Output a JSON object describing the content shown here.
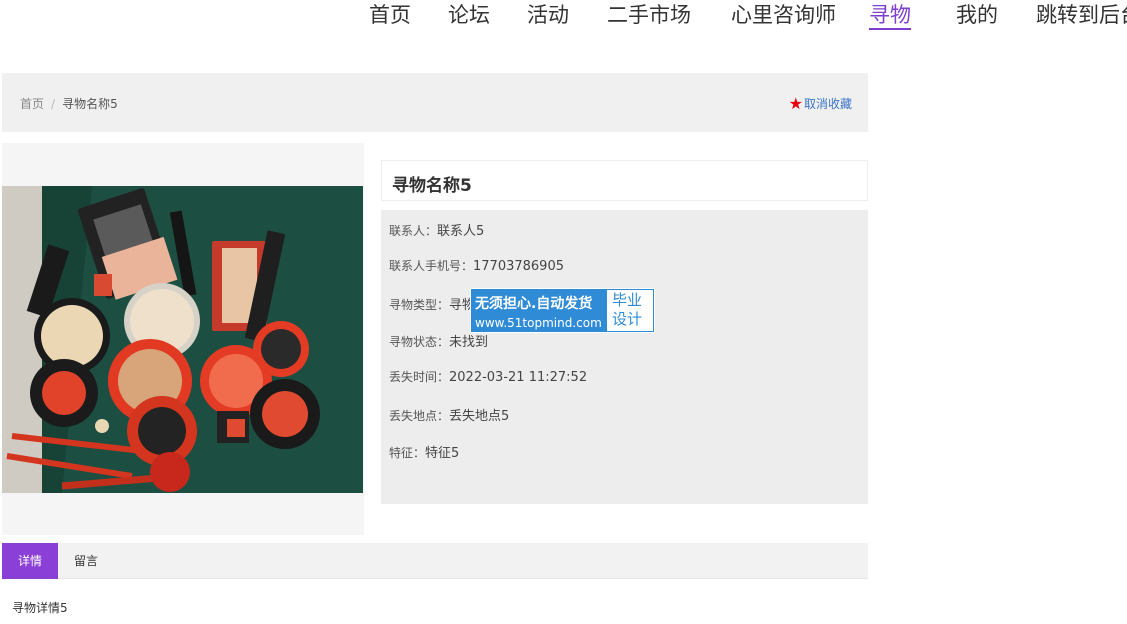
{
  "nav": {
    "items": [
      "首页",
      "论坛",
      "活动",
      "二手市场",
      "心里咨询师",
      "寻物",
      "我的",
      "跳转到后台"
    ],
    "active_index": 5
  },
  "breadcrumb": {
    "home": "首页",
    "separator": "/",
    "current": "寻物名称5"
  },
  "favorite": {
    "label": "取消收藏"
  },
  "item": {
    "title": "寻物名称5",
    "fields": [
      {
        "label": "联系人：",
        "value": "联系人5"
      },
      {
        "label": "联系人手机号：",
        "value": "17703786905"
      },
      {
        "label": "寻物类型：",
        "value": "寻物类型5"
      },
      {
        "label": "寻物状态：",
        "value": "未找到"
      },
      {
        "label": "丢失时间：",
        "value": "2022-03-21 11:27:52"
      },
      {
        "label": "丢失地点：",
        "value": "丢失地点5"
      },
      {
        "label": "特征：",
        "value": "特征5"
      }
    ]
  },
  "watermark": {
    "line1": "无须担心.自动发货",
    "line2": "www.51topmind.com",
    "right_line1": "毕业",
    "right_line2": "设计"
  },
  "tabs": [
    "详情",
    "留言"
  ],
  "detail_text": "寻物详情5",
  "colors": {
    "accent": "#8a3fd6",
    "favorite_star": "#e60012",
    "link": "#3b74c9",
    "watermark": "#2f8bd6"
  }
}
